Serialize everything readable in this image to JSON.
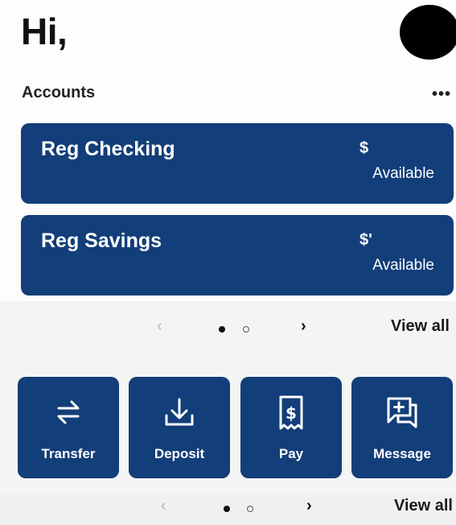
{
  "header": {
    "greeting": "Hi,"
  },
  "accounts": {
    "label": "Accounts",
    "more": "•••",
    "cards": [
      {
        "name": "Reg Checking",
        "amount": "$",
        "available": "Available"
      },
      {
        "name": "Reg Savings",
        "amount": "$'",
        "available": "Available"
      }
    ]
  },
  "pager_accounts": {
    "prev": "‹",
    "next": "›",
    "view_all": "View all"
  },
  "actions": [
    {
      "label": "Transfer",
      "icon": "transfer-arrows-icon"
    },
    {
      "label": "Deposit",
      "icon": "download-tray-icon"
    },
    {
      "label": "Pay",
      "icon": "dollar-receipt-icon"
    },
    {
      "label": "Message",
      "icon": "message-plus-icon"
    }
  ],
  "pager_actions": {
    "prev": "‹",
    "next": "›",
    "view_all": "View all"
  },
  "colors": {
    "card_bg": "#123e79",
    "page_bg": "#f4f4f4"
  }
}
